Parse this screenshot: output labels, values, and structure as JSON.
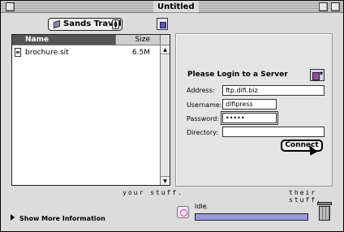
{
  "window": {
    "title": "Untitled"
  },
  "local": {
    "location": "Sands Travel",
    "columns": {
      "name": "Name",
      "size": "Size"
    },
    "files": [
      {
        "name": "brochure.sit",
        "size": "6.5M"
      }
    ],
    "caption": "your stuff."
  },
  "remote": {
    "heading": "Please Login to a Server",
    "address_label": "Address:",
    "address": "ftp.difi.biz",
    "username_label": "Username:",
    "username": "difipress",
    "password_label": "Password:",
    "password": "•••••",
    "directory_label": "Directory:",
    "directory": "",
    "connect_label": "Connect",
    "caption": "their stuff."
  },
  "footer": {
    "more_info": "Show More Information",
    "status": "Idle.",
    "progress_fraction": 1.0
  },
  "colors": {
    "progress_fill": "#9999dd",
    "window_bg": "#dcdcdc"
  }
}
